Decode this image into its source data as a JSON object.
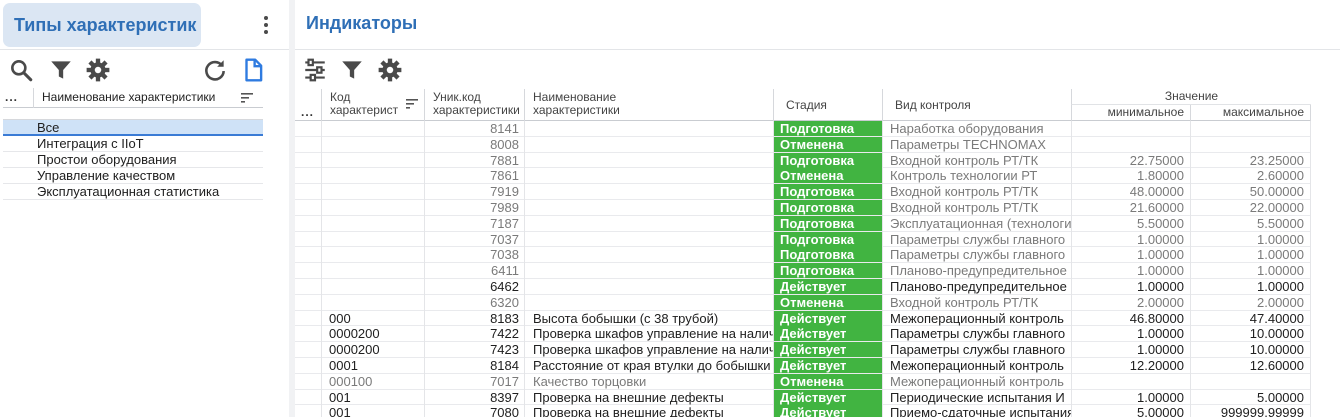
{
  "left": {
    "title": "Типы характеристик",
    "table_header": "Наименование характеристики",
    "row_menu": "...",
    "items": [
      "Все",
      "Интеграция с IIoT",
      "Простои оборудования",
      "Управление качеством",
      "Эксплуатационная статистика"
    ]
  },
  "right": {
    "title": "Индикаторы",
    "row_menu": "...",
    "columns": {
      "code": "Код характерист",
      "uid": "Уник.код характеристики",
      "name": "Наименование характеристики",
      "stage": "Стадия",
      "kind": "Вид контроля",
      "value_group": "Значение",
      "min": "минимальное",
      "max": "максимальное"
    },
    "rows": [
      {
        "code": "",
        "uid": "8141",
        "name": "",
        "stage": "Подготовка",
        "kind": "Наработка оборудования",
        "min": "",
        "max": "",
        "dim": true
      },
      {
        "code": "",
        "uid": "8008",
        "name": "",
        "stage": "Отменена",
        "kind": "Параметры TECHNOMAX",
        "min": "",
        "max": "",
        "dim": true
      },
      {
        "code": "",
        "uid": "7881",
        "name": "",
        "stage": "Подготовка",
        "kind": "Входной контроль РТ/ТК",
        "min": "22.75000",
        "max": "23.25000",
        "dim": true
      },
      {
        "code": "",
        "uid": "7861",
        "name": "",
        "stage": "Отменена",
        "kind": "Контроль технологии РТ",
        "min": "1.80000",
        "max": "2.60000",
        "dim": true
      },
      {
        "code": "",
        "uid": "7919",
        "name": "",
        "stage": "Подготовка",
        "kind": "Входной контроль РТ/ТК",
        "min": "48.00000",
        "max": "50.00000",
        "dim": true
      },
      {
        "code": "",
        "uid": "7989",
        "name": "",
        "stage": "Подготовка",
        "kind": "Входной контроль РТ/ТК",
        "min": "21.60000",
        "max": "22.00000",
        "dim": true
      },
      {
        "code": "",
        "uid": "7187",
        "name": "",
        "stage": "Подготовка",
        "kind": "Эксплуатационная (технологическая)",
        "min": "5.50000",
        "max": "5.50000",
        "dim": true
      },
      {
        "code": "",
        "uid": "7037",
        "name": "",
        "stage": "Подготовка",
        "kind": "Параметры службы главного",
        "min": "1.00000",
        "max": "1.00000",
        "dim": true
      },
      {
        "code": "",
        "uid": "7038",
        "name": "",
        "stage": "Подготовка",
        "kind": "Параметры службы главного",
        "min": "1.00000",
        "max": "1.00000",
        "dim": true
      },
      {
        "code": "",
        "uid": "6411",
        "name": "",
        "stage": "Подготовка",
        "kind": "Планово-предупредительное",
        "min": "1.00000",
        "max": "1.00000",
        "dim": true
      },
      {
        "code": "",
        "uid": "6462",
        "name": "",
        "stage": "Действует",
        "kind": "Планово-предупредительное",
        "min": "1.00000",
        "max": "1.00000",
        "dim": false
      },
      {
        "code": "",
        "uid": "6320",
        "name": "",
        "stage": "Отменена",
        "kind": "Входной контроль РТ/ТК",
        "min": "2.00000",
        "max": "2.00000",
        "dim": true
      },
      {
        "code": "000",
        "uid": "8183",
        "name": "Высота бобышки (с 38 трубой)",
        "stage": "Действует",
        "kind": "Межоперационный контроль",
        "min": "46.80000",
        "max": "47.40000",
        "dim": false
      },
      {
        "code": "0000200",
        "uid": "7422",
        "name": "Проверка шкафов управление на наличие",
        "stage": "Действует",
        "kind": "Параметры службы главного",
        "min": "1.00000",
        "max": "10.00000",
        "dim": false
      },
      {
        "code": "0000200",
        "uid": "7423",
        "name": "Проверка шкафов управление на наличие",
        "stage": "Действует",
        "kind": "Параметры службы главного",
        "min": "1.00000",
        "max": "10.00000",
        "dim": false
      },
      {
        "code": "0001",
        "uid": "8184",
        "name": "Расстояние от края втулки до бобышки",
        "stage": "Действует",
        "kind": "Межоперационный контроль",
        "min": "12.20000",
        "max": "12.60000",
        "dim": false
      },
      {
        "code": "000100",
        "uid": "7017",
        "name": "Качество торцовки",
        "stage": "Отменена",
        "kind": "Межоперационный контроль",
        "min": "",
        "max": "",
        "dim": true
      },
      {
        "code": "001",
        "uid": "8397",
        "name": "Проверка на внешние дефекты",
        "stage": "Действует",
        "kind": "Периодические испытания И",
        "min": "1.00000",
        "max": "5.00000",
        "dim": false
      },
      {
        "code": "001",
        "uid": "7080",
        "name": "Проверка на внешние дефекты",
        "stage": "Действует",
        "kind": "Приемо-сдаточные испытания",
        "min": "5.00000",
        "max": "999999.99999",
        "dim": false
      }
    ]
  },
  "colors": {
    "accent": "#2f6fb6",
    "stage": "#41b441",
    "selected": "#cfe2f7"
  },
  "icons": [
    "search-icon",
    "filter-icon",
    "gear-icon",
    "refresh-icon",
    "document-icon",
    "column-settings-icon",
    "kebab-menu-icon",
    "sort-icon"
  ]
}
